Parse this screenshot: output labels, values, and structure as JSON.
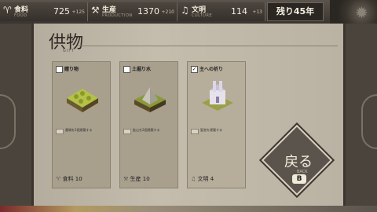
{
  "resources": [
    {
      "icon": "food-icon",
      "glyph": "♈",
      "label": "食料",
      "sub": "FOOD",
      "value": "725",
      "inc": "+125"
    },
    {
      "icon": "hammer-icon",
      "glyph": "⚒",
      "label": "生産",
      "sub": "PRODUCTION",
      "value": "1370",
      "inc": "+210"
    },
    {
      "icon": "music-icon",
      "glyph": "♫",
      "label": "文明",
      "sub": "CULTURE",
      "value": "114",
      "inc": "+13"
    }
  ],
  "years_left": "残り45年",
  "title": "供物",
  "subtitle": "GIFT",
  "cards": [
    {
      "checked": false,
      "name": "贈り物",
      "req": "農場を2個建築する",
      "cost": "食料 10",
      "cost_icon": "♈",
      "selected": false
    },
    {
      "checked": false,
      "name": "土掘り水",
      "req": "鉱山を2個建築する",
      "cost": "生産 10",
      "cost_icon": "⚒",
      "selected": false
    },
    {
      "checked": true,
      "name": "主への祈り",
      "req": "聖堂を建築する",
      "cost": "文明 4",
      "cost_icon": "♫",
      "selected": true
    }
  ],
  "back": {
    "label": "戻る",
    "sub": "BACK",
    "key": "B"
  }
}
